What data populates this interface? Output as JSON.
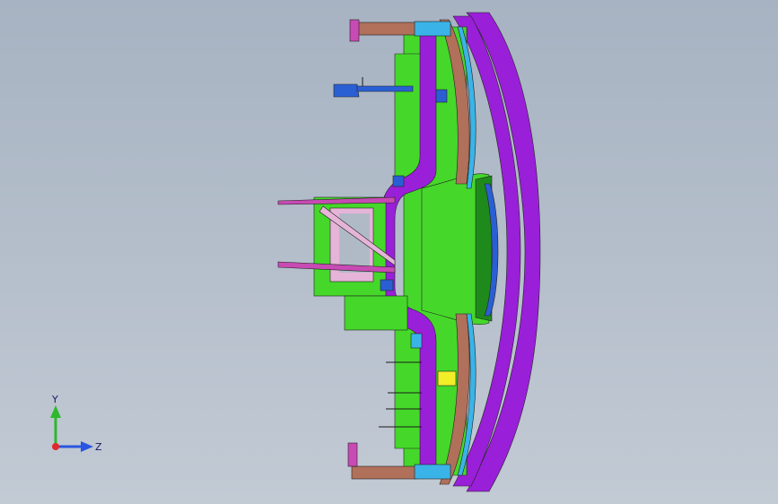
{
  "viewport": {
    "colors": {
      "bg_top": "#a7b3c2",
      "bg_bottom": "#c2cad4",
      "purple": "#9a1fd8",
      "green": "#45d82a",
      "dark_green": "#1f8a1c",
      "brown": "#b0705a",
      "blue": "#2a5fd4",
      "cyan": "#3ab4e8",
      "yellow": "#f2ee28",
      "pink": "#c84ab4",
      "light_pink": "#e6b4d8"
    }
  },
  "triad": {
    "y_label": "Y",
    "z_label": "Z",
    "y_color": "#2db82d",
    "z_color": "#2a55e0",
    "origin_color": "#e02a2a"
  }
}
